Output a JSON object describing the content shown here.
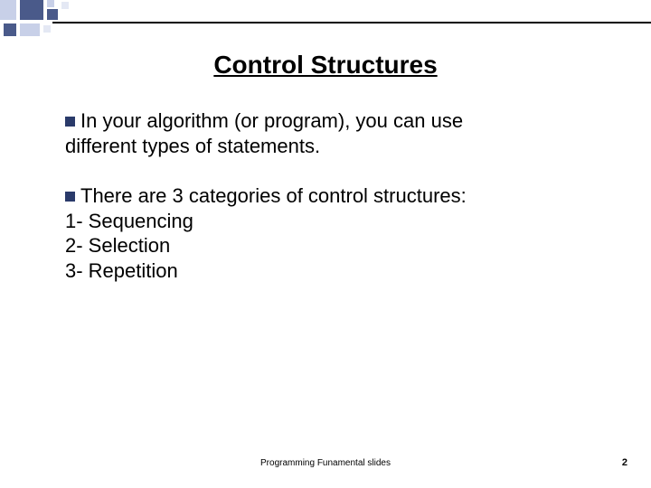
{
  "slide": {
    "title": "Control Structures",
    "bullets": [
      {
        "text_first": "In your algorithm (or program), you can use",
        "text_cont": "different types of statements."
      },
      {
        "text_first": "There are 3 categories of control structures:"
      }
    ],
    "categories": [
      {
        "label": "1-  Sequencing"
      },
      {
        "label": "2-  Selection"
      },
      {
        "label": "3-  Repetition"
      }
    ],
    "footer": "Programming Funamental slides",
    "page_number": "2"
  }
}
